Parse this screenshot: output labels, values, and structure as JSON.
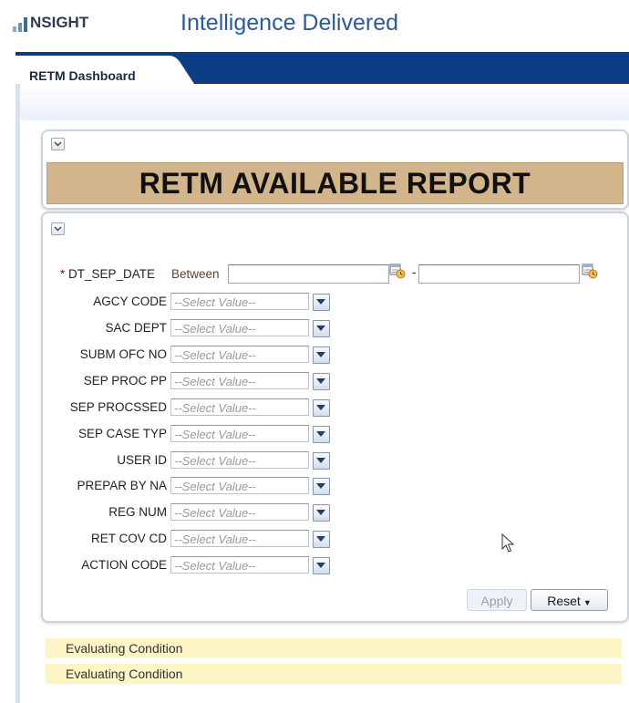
{
  "header": {
    "logo_text": "NSIGHT",
    "tagline": "Intelligence Delivered"
  },
  "tabs": [
    {
      "label": "RETM Dashboard",
      "active": true
    }
  ],
  "report": {
    "title": "RETM AVAILABLE REPORT"
  },
  "prompts": {
    "date_label": "DT_SEP_DATE",
    "required_marker": "*",
    "date_operator": "Between",
    "date_separator": "-",
    "date_from_value": "",
    "date_to_value": "",
    "fields": [
      {
        "label": "AGCY CODE",
        "value": "--Select Value--"
      },
      {
        "label": "SAC DEPT",
        "value": "--Select Value--"
      },
      {
        "label": "SUBM OFC NO",
        "value": "--Select Value--"
      },
      {
        "label": "SEP PROC PP",
        "value": "--Select Value--"
      },
      {
        "label": "SEP PROCSSED",
        "value": "--Select Value--"
      },
      {
        "label": "SEP CASE TYP",
        "value": "--Select Value--"
      },
      {
        "label": "USER ID",
        "value": "--Select Value--"
      },
      {
        "label": "PREPAR BY NA",
        "value": "--Select Value--"
      },
      {
        "label": "REG NUM",
        "value": "--Select Value--"
      },
      {
        "label": "RET COV CD",
        "value": "--Select Value--"
      },
      {
        "label": "ACTION CODE",
        "value": "--Select Value--"
      }
    ],
    "apply_label": "Apply",
    "apply_enabled": false,
    "reset_label": "Reset"
  },
  "status_messages": [
    "Evaluating Condition",
    "Evaluating Condition"
  ],
  "colors": {
    "brand_blue": "#0a3d86",
    "tagline_blue": "#2a5b9a",
    "title_bar": "#d2b58a",
    "status_bg": "#fdf5c6"
  },
  "icons": {
    "calendar": "calendar-icon",
    "dropdown": "chevron-down-icon",
    "collapse": "collapse-icon"
  }
}
